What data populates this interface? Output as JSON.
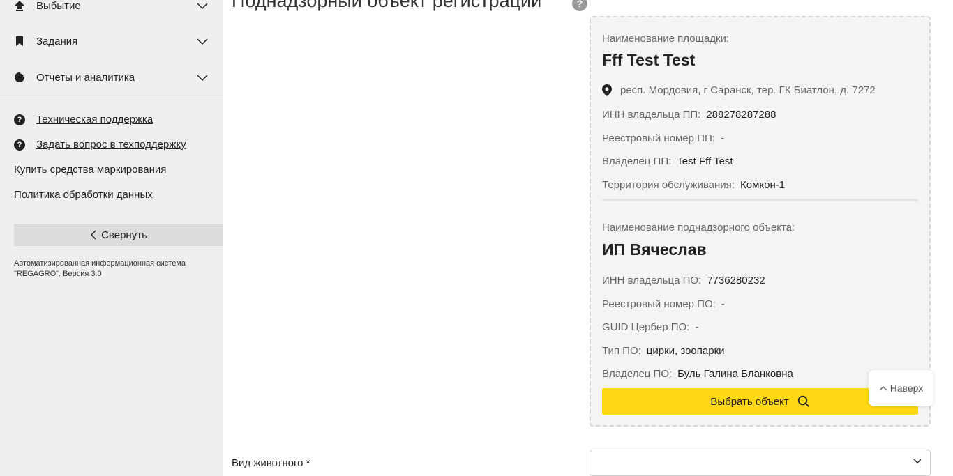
{
  "sidebar": {
    "menu": [
      {
        "label": "Выбытие",
        "icon": "upload-arrow-icon"
      },
      {
        "label": "Задания",
        "icon": "bookmark-icon"
      },
      {
        "label": "Отчеты и аналитика",
        "icon": "pie-chart-icon"
      }
    ],
    "links": {
      "support": "Техническая поддержка",
      "ask_support": "Задать вопрос в техподдержку",
      "buy_marking": "Купить средства маркирования",
      "privacy": "Политика обработки данных"
    },
    "collapse_label": "Свернуть",
    "system_info": "Автоматизированная информационная система \"REGAGRO\". Версия 3.0"
  },
  "main": {
    "title": "Поднадзорный объект регистрации",
    "card": {
      "site_name_label": "Наименование площадки:",
      "site_name": "Fff Test Test",
      "address": "респ. Мордовия, г Саранск, тер. ГК Биатлон, д. 7272",
      "rows_site": [
        {
          "label": "ИНН владельца ПП:",
          "value": "288278287288"
        },
        {
          "label": "Реестровый номер ПП:",
          "value": "-"
        },
        {
          "label": "Владелец ПП:",
          "value": "Test Fff Test"
        },
        {
          "label": "Территория обслуживания:",
          "value": "Комкон-1"
        }
      ],
      "object_name_label": "Наименование поднадзорного объекта:",
      "object_name": "ИП Вячеслав",
      "rows_object": [
        {
          "label": "ИНН владельца ПО:",
          "value": "7736280232"
        },
        {
          "label": "Реестровый номер ПО:",
          "value": "-"
        },
        {
          "label": "GUID Цербер ПО:",
          "value": "-"
        },
        {
          "label": "Тип ПО:",
          "value": "цирки, зоопарки"
        },
        {
          "label": "Владелец ПО:",
          "value": "Буль Галина Бланковна"
        }
      ],
      "select_button": "Выбрать объект"
    },
    "to_top": "Наверх",
    "animal_type_label": "Вид животного *",
    "animal_type_value": ""
  },
  "colors": {
    "accent": "#ffd814",
    "sidebar_bg": "#efefef",
    "card_bg": "#f4f4f4"
  }
}
